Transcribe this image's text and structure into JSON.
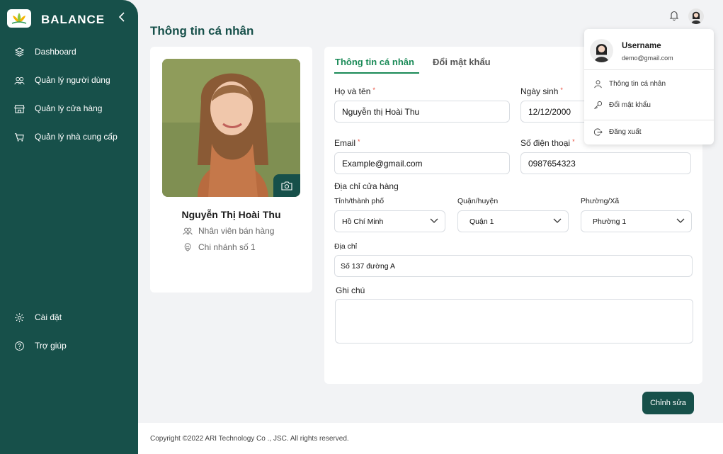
{
  "sidebar": {
    "brand": "BALANCE",
    "items": [
      {
        "label": "Dashboard"
      },
      {
        "label": "Quản lý người dùng"
      },
      {
        "label": "Quản lý cửa hàng"
      },
      {
        "label": "Quản lý nhà cung cấp"
      },
      {
        "label": "Cài đặt"
      },
      {
        "label": "Trợ giúp"
      }
    ]
  },
  "page": {
    "title": "Thông tin cá nhân"
  },
  "profile": {
    "name": "Nguyễn Thị Hoài Thu",
    "role": "Nhân viên bán hàng",
    "branch": "Chi nhánh số 1"
  },
  "tabs": [
    {
      "label": "Thông tin cá nhân"
    },
    {
      "label": "Đổi mật khẩu"
    }
  ],
  "form": {
    "fullname_label": "Họ và tên",
    "fullname_value": "Nguyễn thị Hoài Thu",
    "dob_label": "Ngày sinh",
    "dob_value": "12/12/2000",
    "email_label": "Email",
    "email_value": "Example@gmail.com",
    "phone_label": "Số điện thoại",
    "phone_value": "0987654323",
    "store_address_label": "Địa chỉ cửa hàng",
    "province_label": "Tỉnh/thành phố",
    "province_value": "Hồ Chí Minh",
    "district_label": "Quận/huyện",
    "district_value": "Quận 1",
    "ward_label": "Phường/Xã",
    "ward_value": "Phường 1",
    "address_label": "Địa chỉ",
    "address_value": "Số 137 đường A",
    "note_label": "Ghi chú",
    "required_mark": "*"
  },
  "actions": {
    "edit_label": "Chỉnh sửa"
  },
  "footer": {
    "copyright": "Copyright ©2022 ARI Technology Co ., JSC. All rights reserved."
  },
  "user_menu": {
    "username": "Username",
    "email": "demo@gmail.com",
    "items": [
      {
        "label": "Thông tin cá nhân"
      },
      {
        "label": "Đổi mật khẩu"
      },
      {
        "label": "Đăng xuất"
      }
    ]
  },
  "colors": {
    "primary": "#17504a",
    "accent": "#1a8a57",
    "required": "#e74c3c"
  }
}
